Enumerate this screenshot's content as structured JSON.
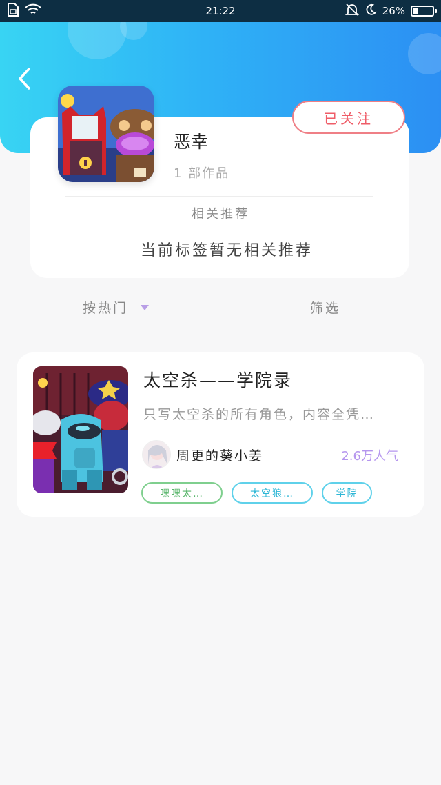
{
  "status_bar": {
    "time": "21:22",
    "battery": "26%",
    "battery_level": 0.26
  },
  "profile": {
    "name": "恶幸",
    "works_count": "1 部作品",
    "follow_label": "已关注"
  },
  "related": {
    "title": "相关推荐",
    "empty_text": "当前标签暂无相关推荐"
  },
  "sort_bar": {
    "sort_label": "按热门",
    "filter_label": "筛选"
  },
  "works": [
    {
      "title": "太空杀——学院录",
      "description": "只写太空杀的所有角色，内容全凭…",
      "author": "周更的葵小姜",
      "popularity": "2.6万人气",
      "tags": [
        "嘿嘿太…",
        "太空狼…",
        "学院"
      ]
    }
  ],
  "colors": {
    "header_gradient": [
      "#38d4f3",
      "#2c8ff3"
    ],
    "follow_red": "#ef5d68",
    "popularity_purple": "#b596ee",
    "tag_green": "#59b56b",
    "tag_cyan": "#2fb7d6"
  }
}
